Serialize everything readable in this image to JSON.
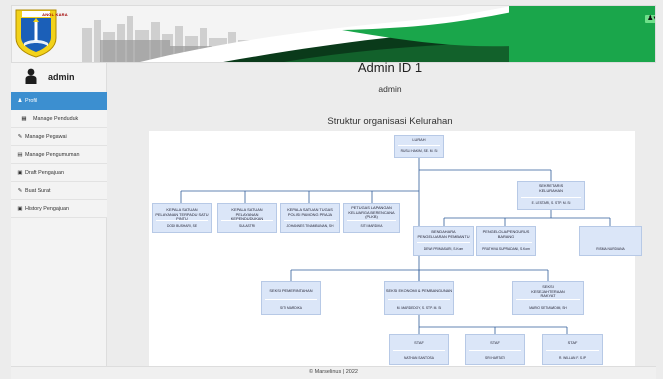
{
  "header": {
    "emblem_label": "ANGL KARA",
    "user_menu_glyph": "♟▾",
    "colors": {
      "accent_green": "#1aa64b",
      "dark_green": "#0a3a1a",
      "banner_white": "#f4f4f4",
      "toggle_green": "#6fe08a"
    }
  },
  "sidebar": {
    "username": "admin",
    "active_color": "#3c8fd0",
    "items": [
      {
        "label": "Profil",
        "icon": "user-icon"
      },
      {
        "label": "Manage Penduduk",
        "icon": "table-icon"
      },
      {
        "label": "Manage Pegawai",
        "icon": "pencil-icon"
      },
      {
        "label": "Manage Pengumuman",
        "icon": "list-icon"
      },
      {
        "label": "Draft Pengajuan",
        "icon": "inbox-icon"
      },
      {
        "label": "Buat Surat",
        "icon": "pencil-icon"
      },
      {
        "label": "History Pengajuan",
        "icon": "inbox-icon"
      }
    ]
  },
  "main": {
    "title": "Admin ID 1",
    "subtitle": "admin",
    "structure_heading": "Struktur organisasi Kelurahan"
  },
  "org": {
    "box_color": "#dbe6f8",
    "lurah": {
      "role": "LURAH",
      "person": "RUSLI HAKIM, SE. M. Si"
    },
    "sekretaris": {
      "role": "SEKRETARIS KELURAHAN",
      "person": "E. LESTARI, S. STP. M. Si"
    },
    "sekretariat_staff": [
      {
        "role": "BENDAHARA PENGELUARAN PEMBANTU",
        "person": "DEWI PRIMASARI, S.Kom"
      },
      {
        "role": "PENGELOLA/PENGURUS BARANG",
        "person": "PRATHIVA SUPRADANI, S.Kom"
      },
      {
        "role": "",
        "person": "RISMA NURDIANA"
      }
    ],
    "satuan": [
      {
        "role": "KEPALA SATUAN PELAYANAN TERPADU SATU PINTU",
        "person": "DODI BUSHARI, SE"
      },
      {
        "role": "KEPALA SATUAN PELAYANAN KEPENDUDUKAN",
        "person": "SULASTRI"
      },
      {
        "role": "KEPALA SATUAN TUGAS POLISI PAMONG PRAJA",
        "person": "JOHANNES TINAMBUNAN, SH"
      },
      {
        "role": "PETUGAS LAPANGAN KELUARGA BERENCANA (PLKB)",
        "person": "SITI MARDIKA"
      }
    ],
    "seksi": [
      {
        "role": "SEKSI PEMERINTAHAN",
        "person": "SITI MARDIKA"
      },
      {
        "role": "SEKSI EKONOMI & PEMBANGUNAN",
        "person": "M. MARDEDOY, S. STP. M. Si"
      },
      {
        "role": "SEKSI KESEJAHTERAAN RAKYAT",
        "person": "MARIO SETIAWIDIM, SH"
      }
    ],
    "staf": [
      {
        "role": "STAF",
        "person": "NATHAN SANTOSA"
      },
      {
        "role": "STAF",
        "person": "SRI HARTATI"
      },
      {
        "role": "STAF",
        "person": "R. WILLAN F. S.IP"
      }
    ]
  },
  "footer": {
    "text": "© Marselinus  | 2022"
  }
}
